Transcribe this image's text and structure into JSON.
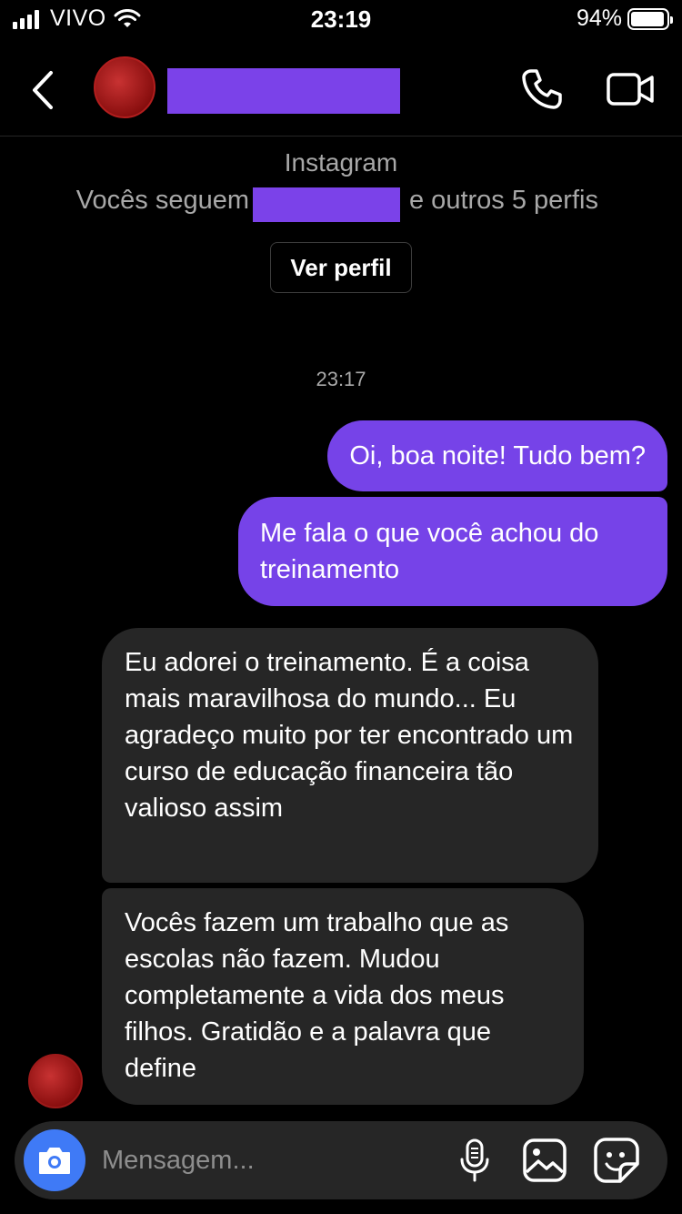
{
  "status_bar": {
    "carrier": "VIVO",
    "time": "23:19",
    "battery": "94%",
    "battery_level": 0.94
  },
  "header": {
    "contact_name": ""
  },
  "profile_info": {
    "subtitle": "Instagram",
    "follow_prefix": "Vocês seguem",
    "follow_suffix": "e outros 5 perfis",
    "view_profile_label": "Ver perfil"
  },
  "chat": {
    "timestamp": "23:17",
    "messages": [
      {
        "direction": "outgoing",
        "text": "Oi, boa noite! Tudo bem?"
      },
      {
        "direction": "outgoing",
        "text": "Me fala o que você achou do treinamento"
      },
      {
        "direction": "incoming",
        "text": "Eu adorei o treinamento. É a coisa mais maravilhosa do mundo... Eu agradeço muito por ter encontrado um curso de educação financeira tão valioso assim"
      },
      {
        "direction": "incoming",
        "text": "Vocês fazem um trabalho que as escolas não fazem. Mudou completamente a vida dos meus filhos. Gratidão e a palavra que define"
      }
    ]
  },
  "composer": {
    "placeholder": "Mensagem...",
    "icons": [
      "camera-icon",
      "microphone-icon",
      "gallery-icon",
      "sticker-icon"
    ]
  },
  "colors": {
    "outgoing_bubble": "#7643e8",
    "incoming_bubble": "#262626",
    "camera_button": "#3f7af6",
    "redaction": "#7b42e9"
  }
}
